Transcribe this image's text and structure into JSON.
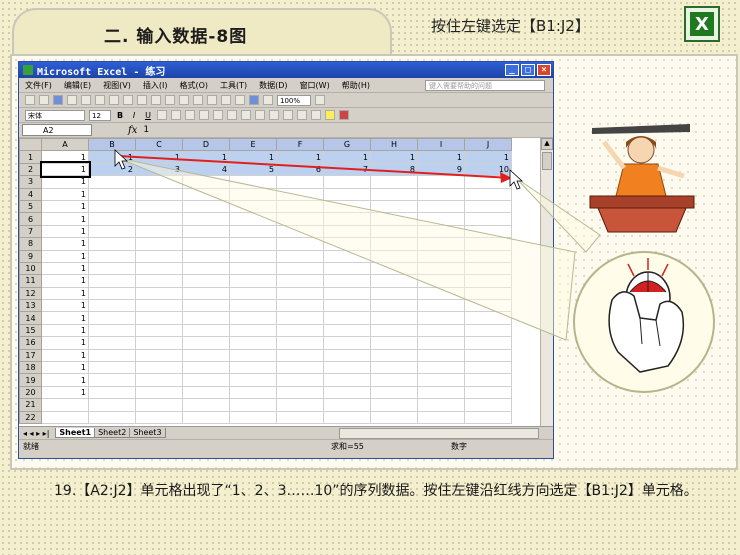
{
  "header": {
    "title": "二. 输入数据-8图",
    "hint": "按住左键选定【B1:J2】",
    "logo_letter": "X"
  },
  "excel": {
    "window_title": "Microsoft Excel - 练习",
    "menu": [
      "文件(F)",
      "编辑(E)",
      "视图(V)",
      "插入(I)",
      "格式(O)",
      "工具(T)",
      "数据(D)",
      "窗口(W)",
      "帮助(H)"
    ],
    "help_placeholder": "键入需要帮助的问题",
    "zoom": "100%",
    "font": "宋体",
    "font_size": "12",
    "name_box": "A2",
    "fx_symbol": "fx",
    "formula_value": "1",
    "columns": [
      "A",
      "B",
      "C",
      "D",
      "E",
      "F",
      "G",
      "H",
      "I",
      "J"
    ],
    "rows": [
      [
        "1",
        "1",
        "1",
        "1",
        "1",
        "1",
        "1",
        "1",
        "1",
        "1"
      ],
      [
        "1",
        "2",
        "3",
        "4",
        "5",
        "6",
        "7",
        "8",
        "9",
        "10"
      ],
      [
        "1",
        "",
        "",
        "",
        "",
        "",
        "",
        "",
        "",
        ""
      ],
      [
        "1",
        "",
        "",
        "",
        "",
        "",
        "",
        "",
        "",
        ""
      ],
      [
        "1",
        "",
        "",
        "",
        "",
        "",
        "",
        "",
        "",
        ""
      ],
      [
        "1",
        "",
        "",
        "",
        "",
        "",
        "",
        "",
        "",
        ""
      ],
      [
        "1",
        "",
        "",
        "",
        "",
        "",
        "",
        "",
        "",
        ""
      ],
      [
        "1",
        "",
        "",
        "",
        "",
        "",
        "",
        "",
        "",
        ""
      ],
      [
        "1",
        "",
        "",
        "",
        "",
        "",
        "",
        "",
        "",
        ""
      ],
      [
        "1",
        "",
        "",
        "",
        "",
        "",
        "",
        "",
        "",
        ""
      ],
      [
        "1",
        "",
        "",
        "",
        "",
        "",
        "",
        "",
        "",
        ""
      ],
      [
        "1",
        "",
        "",
        "",
        "",
        "",
        "",
        "",
        "",
        ""
      ],
      [
        "1",
        "",
        "",
        "",
        "",
        "",
        "",
        "",
        "",
        ""
      ],
      [
        "1",
        "",
        "",
        "",
        "",
        "",
        "",
        "",
        "",
        ""
      ],
      [
        "1",
        "",
        "",
        "",
        "",
        "",
        "",
        "",
        "",
        ""
      ],
      [
        "1",
        "",
        "",
        "",
        "",
        "",
        "",
        "",
        "",
        ""
      ],
      [
        "1",
        "",
        "",
        "",
        "",
        "",
        "",
        "",
        "",
        ""
      ],
      [
        "1",
        "",
        "",
        "",
        "",
        "",
        "",
        "",
        "",
        ""
      ],
      [
        "1",
        "",
        "",
        "",
        "",
        "",
        "",
        "",
        "",
        ""
      ],
      [
        "1",
        "",
        "",
        "",
        "",
        "",
        "",
        "",
        "",
        ""
      ],
      [
        "",
        "",
        "",
        "",
        "",
        "",
        "",
        "",
        "",
        ""
      ],
      [
        "",
        "",
        "",
        "",
        "",
        "",
        "",
        "",
        "",
        ""
      ]
    ],
    "sheets": [
      "Sheet1",
      "Sheet2",
      "Sheet3"
    ],
    "active_sheet": "Sheet1",
    "status_ready": "就绪",
    "status_sum": "求和=55",
    "status_mode": "数字"
  },
  "caption": {
    "text": "19.【A2:J2】单元格出现了“1、2、3……10”的序列数据。按住左键沿红线方向选定【B1:J2】单元格。"
  },
  "colors": {
    "arrow": "#e02020",
    "selection": "#bcd0f0",
    "title_bar": "#2f5fd6"
  }
}
